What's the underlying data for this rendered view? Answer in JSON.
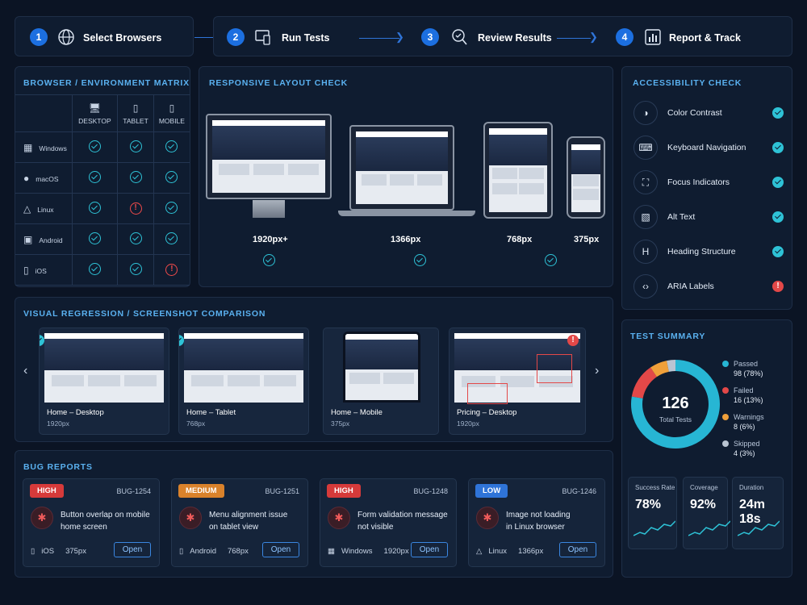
{
  "steps": [
    {
      "num": "1",
      "label": "Select Browsers"
    },
    {
      "num": "2",
      "label": "Run Tests"
    },
    {
      "num": "3",
      "label": "Review Results"
    },
    {
      "num": "4",
      "label": "Report & Track"
    }
  ],
  "matrix": {
    "title": "BROWSER / ENVIRONMENT MATRIX",
    "columns": [
      "DESKTOP",
      "TABLET",
      "MOBILE"
    ],
    "rows": [
      {
        "os": "Windows",
        "status": [
          "pass",
          "pass",
          "pass"
        ]
      },
      {
        "os": "macOS",
        "status": [
          "pass",
          "pass",
          "pass"
        ]
      },
      {
        "os": "Linux",
        "status": [
          "pass",
          "fail",
          "pass"
        ]
      },
      {
        "os": "Android",
        "status": [
          "pass",
          "pass",
          "pass"
        ]
      },
      {
        "os": "iOS",
        "status": [
          "pass",
          "pass",
          "fail"
        ]
      }
    ]
  },
  "responsive": {
    "title": "RESPONSIVE LAYOUT CHECK",
    "devices": [
      {
        "size": "1920px+",
        "status": "pass"
      },
      {
        "size": "1366px",
        "status": "pass"
      },
      {
        "size": "768px",
        "status": "pass"
      },
      {
        "size": "375px",
        "status": "pass"
      }
    ]
  },
  "accessibility": {
    "title": "ACCESSIBILITY CHECK",
    "items": [
      {
        "label": "Color Contrast",
        "icon": "contrast-icon",
        "status": "pass"
      },
      {
        "label": "Keyboard Navigation",
        "icon": "keyboard-icon",
        "status": "pass"
      },
      {
        "label": "Focus Indicators",
        "icon": "focus-icon",
        "status": "pass"
      },
      {
        "label": "Alt Text",
        "icon": "image-icon",
        "status": "pass"
      },
      {
        "label": "Heading Structure",
        "icon": "heading-icon",
        "status": "pass"
      },
      {
        "label": "ARIA Labels",
        "icon": "code-icon",
        "status": "fail"
      }
    ]
  },
  "regression": {
    "title": "VISUAL REGRESSION / SCREENSHOT COMPARISON",
    "items": [
      {
        "title": "Home – Desktop",
        "size": "1920px",
        "status": "pass"
      },
      {
        "title": "Home – Tablet",
        "size": "768px",
        "status": "pass"
      },
      {
        "title": "Home – Mobile",
        "size": "375px",
        "status": "none"
      },
      {
        "title": "Pricing – Desktop",
        "size": "1920px",
        "status": "fail"
      }
    ]
  },
  "bugs": {
    "title": "BUG REPORTS",
    "items": [
      {
        "severity": "HIGH",
        "sev_color": "#d63a3a",
        "id": "BUG-1254",
        "line1": "Button overlap on mobile",
        "line2": "home screen",
        "platform": "iOS",
        "res": "375px",
        "action": "Open"
      },
      {
        "severity": "MEDIUM",
        "sev_color": "#d9822b",
        "id": "BUG-1251",
        "line1": "Menu alignment issue",
        "line2": "on tablet view",
        "platform": "Android",
        "res": "768px",
        "action": "Open"
      },
      {
        "severity": "HIGH",
        "sev_color": "#d63a3a",
        "id": "BUG-1248",
        "line1": "Form validation message",
        "line2": "not visible",
        "platform": "Windows",
        "res": "1920px",
        "action": "Open"
      },
      {
        "severity": "LOW",
        "sev_color": "#2f74d8",
        "id": "BUG-1246",
        "line1": "Image not loading",
        "line2": "in Linux browser",
        "platform": "Linux",
        "res": "1366px",
        "action": "Open"
      }
    ]
  },
  "summary": {
    "title": "TEST SUMMARY",
    "total": "126",
    "total_label": "Total Tests",
    "chart_data": {
      "type": "pie",
      "categories": [
        "Passed",
        "Failed",
        "Warnings",
        "Skipped"
      ],
      "values": [
        98,
        16,
        8,
        4
      ],
      "colors": [
        "#27b6d4",
        "#e34848",
        "#f0a03a",
        "#b9c4d2"
      ]
    },
    "legend": [
      {
        "label": "Passed",
        "value": "98 (78%)",
        "color": "#27b6d4"
      },
      {
        "label": "Failed",
        "value": "16 (13%)",
        "color": "#e34848"
      },
      {
        "label": "Warnings",
        "value": "8 (6%)",
        "color": "#f0a03a"
      },
      {
        "label": "Skipped",
        "value": "4 (3%)",
        "color": "#b9c4d2"
      }
    ],
    "stats": [
      {
        "label": "Success Rate",
        "value": "78%"
      },
      {
        "label": "Coverage",
        "value": "92%"
      },
      {
        "label": "Duration",
        "value": "24m 18s"
      }
    ]
  }
}
